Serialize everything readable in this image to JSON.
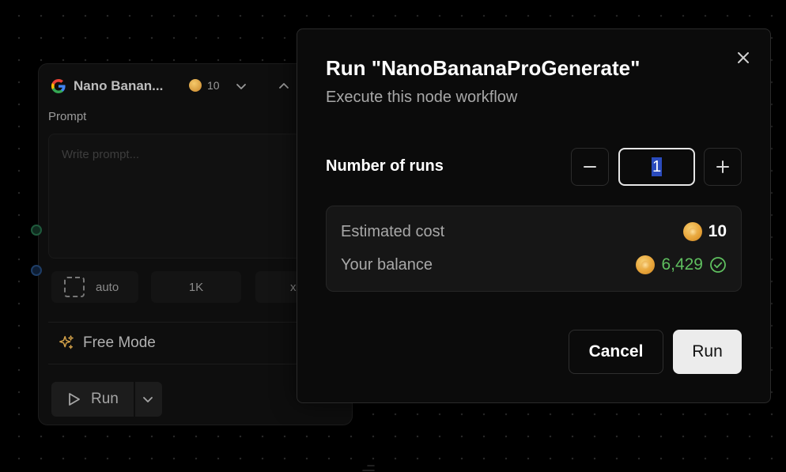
{
  "node": {
    "title": "Nano Banan...",
    "cost": "10",
    "prompt_label": "Prompt",
    "prompt_placeholder": "Write prompt...",
    "aspect_label": "auto",
    "resolution_label": "1K",
    "count_label": "x",
    "free_mode_label": "Free Mode",
    "run_label": "Run",
    "icons": [
      "google-icon",
      "coin-icon",
      "chevron-down-icon",
      "chevron-up-icon",
      "aspect-ratio-icon",
      "sparkle-icon",
      "play-icon"
    ]
  },
  "modal": {
    "title": "Run \"NanoBananaProGenerate\"",
    "subtitle": "Execute this node workflow",
    "runs_label": "Number of runs",
    "runs_value": "1",
    "estimated_cost_label": "Estimated cost",
    "estimated_cost_value": "10",
    "balance_label": "Your balance",
    "balance_value": "6,429",
    "cancel_label": "Cancel",
    "run_label": "Run",
    "colors": {
      "balance_ok": "#5fbf5f",
      "coin": "#e8a53a",
      "run_button_bg": "#ececec"
    }
  }
}
